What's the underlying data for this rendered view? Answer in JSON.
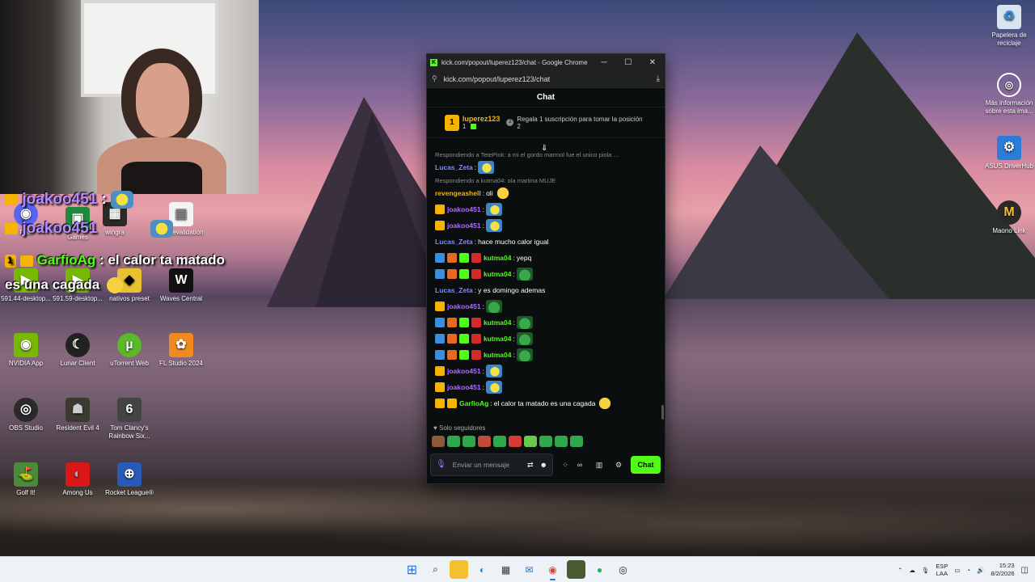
{
  "webcam": {
    "label": "webcam-feed"
  },
  "stream_overlay": {
    "line1_user": "joakoo451",
    "line1_sep": ":",
    "line2_user": "joakoo451",
    "line3_user": "GarfioAg",
    "line3_text": ": el calor ta matado",
    "line4_text": "es una cagada",
    "position_badge": "1"
  },
  "desktop_icons": {
    "recycle": "Papelera de reciclaje",
    "info": "Más información sobre esta ima...",
    "asus": "ASUS DriverHub",
    "maono": "Maono Link",
    "games": "Games",
    "discord": "Disc",
    "wingraph": "wingra",
    "lcensevalidation": "censevalidation",
    "nvidia_591_44": "591.44-desktop...",
    "nvidia_591_59": "591.59-desktop...",
    "nativos": "nativos preset",
    "waves": "Waves Central",
    "nvidia_app": "NVIDIA App",
    "lunar": "Lunar Client",
    "utorrent": "uTorrent Web",
    "flstudio": "FL Studio 2024",
    "obs": "OBS Studio",
    "re4": "Resident Evil 4",
    "r6": "Tom Clancy's Rainbow Six...",
    "golf": "Golf It!",
    "amongus": "Among Us",
    "rocket": "Rocket League®"
  },
  "chrome": {
    "title": "kick.com/popout/luperez123/chat - Google Chrome",
    "url": "kick.com/popout/luperez123/chat",
    "minimize": "─",
    "maximize": "☐",
    "close": "✕"
  },
  "chat": {
    "header": "Chat",
    "top_sub": {
      "position": "1",
      "user": "luperez123",
      "count": "1",
      "gift_text": "Regala 1 suscripción para tomar la posición 2"
    },
    "messages": [
      {
        "kind": "reply",
        "text": "Respondiendo a TetePink: a mi el gordo marmol fue el unico piola ..."
      },
      {
        "kind": "msg",
        "user": "Lucas_Zeta",
        "color": "#7a8cff",
        "badges": [],
        "text": "",
        "emote": "blue"
      },
      {
        "kind": "reply",
        "text": "Respondiendo a kutma04: ola martina MUJE"
      },
      {
        "kind": "msg",
        "user": "revengeashell",
        "color": "#f5b400",
        "badges": [],
        "text": "oli",
        "emote": "yellow"
      },
      {
        "kind": "msg",
        "user": "joakoo451",
        "color": "#b06cff",
        "badges": [
          "crown"
        ],
        "text": "",
        "emote": "blue"
      },
      {
        "kind": "msg",
        "user": "joakoo451",
        "color": "#b06cff",
        "badges": [
          "crown"
        ],
        "text": "",
        "emote": "blue"
      },
      {
        "kind": "msg",
        "user": "Lucas_Zeta",
        "color": "#7a8cff",
        "badges": [],
        "text": "hace mucho calor igual",
        "emote": ""
      },
      {
        "kind": "msg",
        "user": "kutma04",
        "color": "#53fc18",
        "badges": [
          "blue",
          "orange",
          "green",
          "red"
        ],
        "text": "yepq",
        "emote": ""
      },
      {
        "kind": "msg",
        "user": "kutma04",
        "color": "#53fc18",
        "badges": [
          "blue",
          "orange",
          "green",
          "red"
        ],
        "text": "",
        "emote": "frog"
      },
      {
        "kind": "msg",
        "user": "Lucas_Zeta",
        "color": "#7a8cff",
        "badges": [],
        "text": "y es domingo ademas",
        "emote": ""
      },
      {
        "kind": "msg",
        "user": "joakoo451",
        "color": "#b06cff",
        "badges": [
          "crown"
        ],
        "text": "",
        "emote": "frog"
      },
      {
        "kind": "msg",
        "user": "kutma04",
        "color": "#53fc18",
        "badges": [
          "blue",
          "orange",
          "green",
          "red"
        ],
        "text": "",
        "emote": "frog"
      },
      {
        "kind": "msg",
        "user": "kutma04",
        "color": "#53fc18",
        "badges": [
          "blue",
          "orange",
          "green",
          "red"
        ],
        "text": "",
        "emote": "frog"
      },
      {
        "kind": "msg",
        "user": "kutma04",
        "color": "#53fc18",
        "badges": [
          "blue",
          "orange",
          "green",
          "red"
        ],
        "text": "",
        "emote": "frog"
      },
      {
        "kind": "msg",
        "user": "joakoo451",
        "color": "#b06cff",
        "badges": [
          "crown"
        ],
        "text": "",
        "emote": "blue"
      },
      {
        "kind": "msg",
        "user": "joakoo451",
        "color": "#b06cff",
        "badges": [
          "crown"
        ],
        "text": "",
        "emote": "blue"
      },
      {
        "kind": "msg",
        "user": "GarfioAg",
        "color": "#53fc18",
        "badges": [
          "crown",
          "gold"
        ],
        "text": "el calor ta matado es una cagada",
        "emote": "yellow"
      }
    ],
    "followers_only": "Solo seguidores",
    "input_placeholder": "Enviar un mensaje",
    "send_label": "Chat"
  },
  "taskbar": {
    "lang_top": "ESP",
    "lang_bottom": "LAA",
    "time": "15:23",
    "date": "8/2/2026"
  },
  "colors": {
    "kick_green": "#53fc18",
    "gold": "#f5b400",
    "purple": "#b06cff"
  }
}
